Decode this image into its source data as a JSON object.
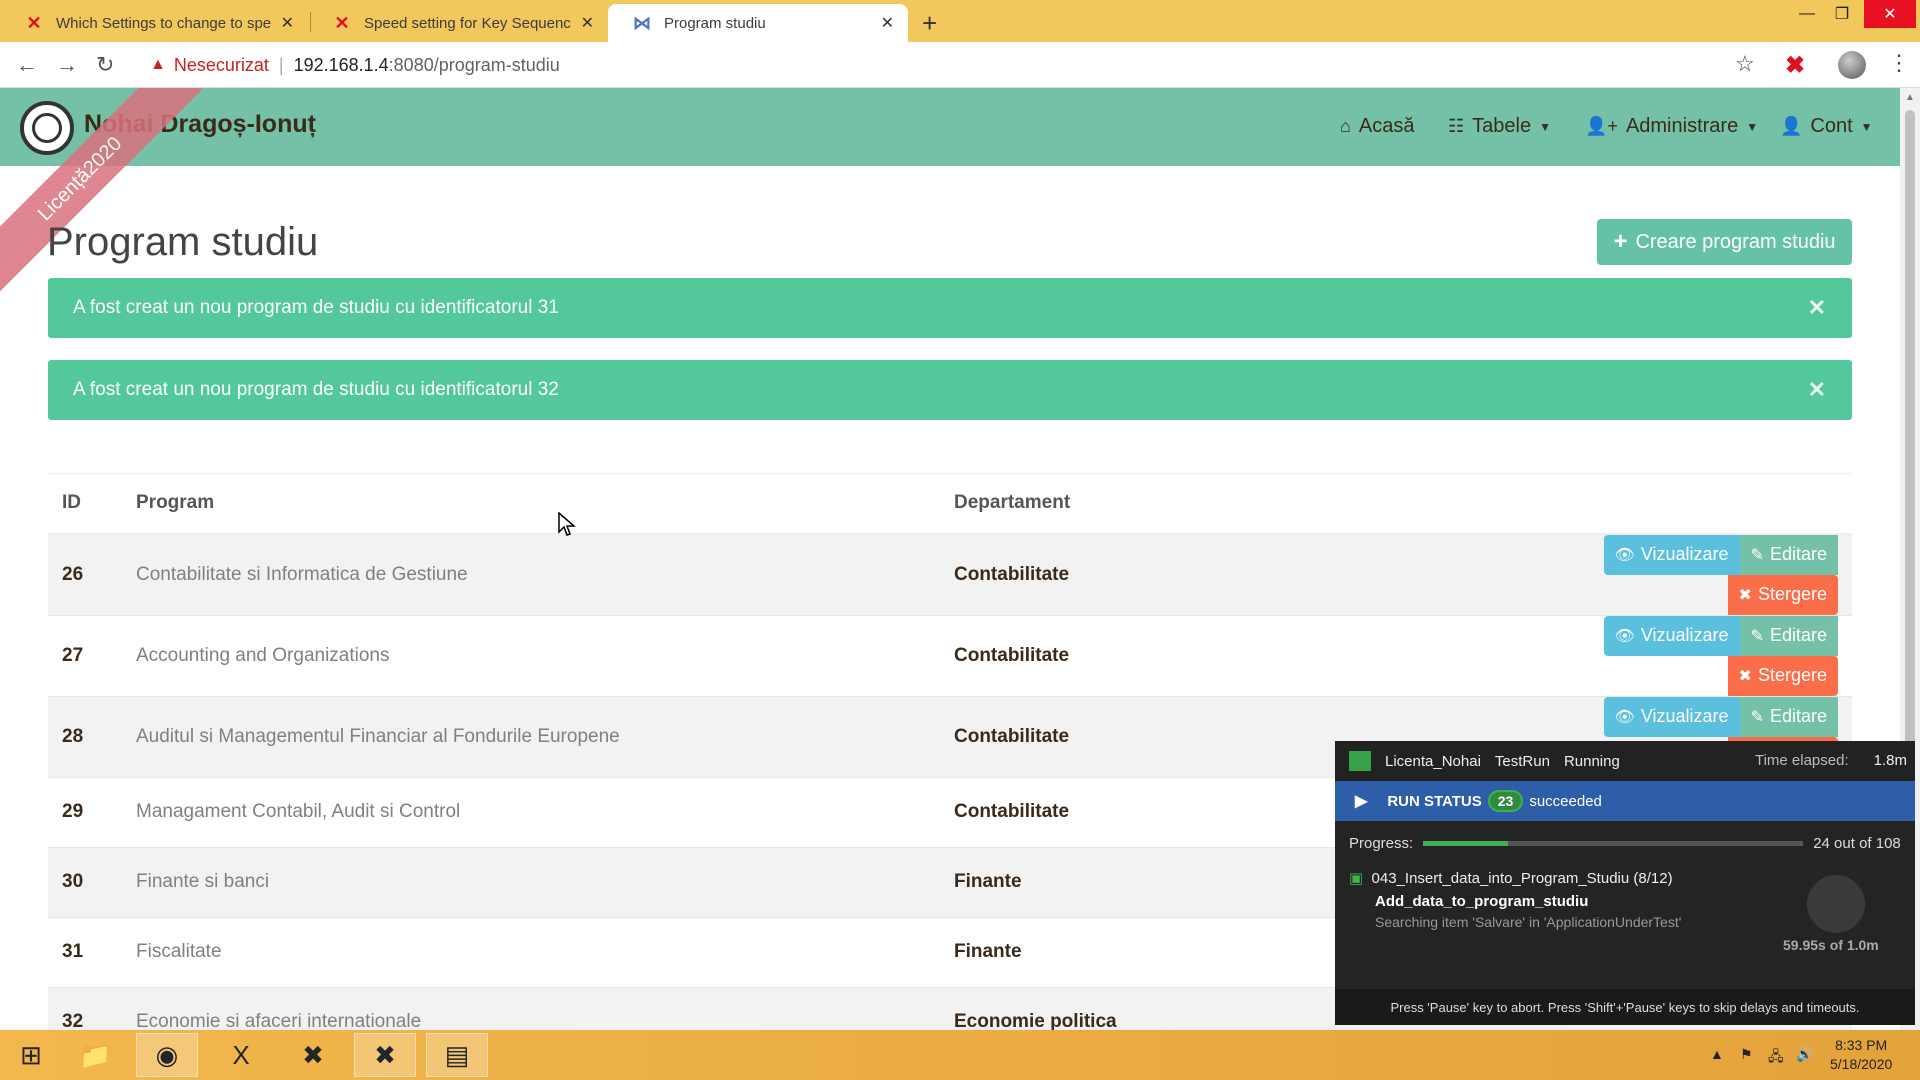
{
  "browser": {
    "tabs": [
      {
        "title": "Which Settings to change to spe"
      },
      {
        "title": "Speed setting for Key Sequence /"
      },
      {
        "title": "Program studiu"
      }
    ],
    "insecure_label": "Nesecurizat",
    "host": "192.168.1.4",
    "path": ":8080/program-studiu"
  },
  "navbar": {
    "brand": "Nohai Dragoș-Ionuț",
    "ribbon": "Licență2020",
    "items": [
      {
        "label": "Acasă",
        "icon": "home-icon"
      },
      {
        "label": "Tabele",
        "icon": "table-icon"
      },
      {
        "label": "Administrare",
        "icon": "user-plus-icon"
      },
      {
        "label": "Cont",
        "icon": "user-icon"
      }
    ]
  },
  "page": {
    "title": "Program studiu",
    "create_button": "Creare program studiu",
    "alerts": [
      "A fost creat un nou program de studiu cu identificatorul 31",
      "A fost creat un nou program de studiu cu identificatorul 32"
    ]
  },
  "table": {
    "headers": {
      "id": "ID",
      "program": "Program",
      "dept": "Departament"
    },
    "actions": {
      "view": "Vizualizare",
      "edit": "Editare",
      "delete": "Stergere"
    },
    "rows": [
      {
        "id": "26",
        "program": "Contabilitate si Informatica de Gestiune",
        "dept": "Contabilitate"
      },
      {
        "id": "27",
        "program": "Accounting and Organizations",
        "dept": "Contabilitate"
      },
      {
        "id": "28",
        "program": "Auditul si Managementul Financiar al Fondurile Europene",
        "dept": "Contabilitate"
      },
      {
        "id": "29",
        "program": "Managament Contabil, Audit si Control",
        "dept": "Contabilitate"
      },
      {
        "id": "30",
        "program": "Finante si banci",
        "dept": "Finante"
      },
      {
        "id": "31",
        "program": "Fiscalitate",
        "dept": "Finante"
      },
      {
        "id": "32",
        "program": "Economie si afaceri internationale",
        "dept": "Economie politica"
      }
    ]
  },
  "ranorex": {
    "solution": "Licenta_Nohai",
    "suite": "TestRun",
    "state": "Running",
    "elapsed_label": "Time elapsed:",
    "elapsed": "1.8m",
    "run_status": "RUN STATUS",
    "succeeded_count": "23",
    "succeeded_label": "succeeded",
    "progress_label": "Progress:",
    "progress_text": "24 out of 108",
    "progress_fraction": 0.222,
    "module": "043_Insert_data_into_Program_Studiu (8/12)",
    "action": "Add_data_to_program_studiu",
    "searching": "Searching item 'Salvare' in 'ApplicationUnderTest'",
    "timeout": "59.95s of 1.0m",
    "footer": "Press 'Pause' key to abort. Press 'Shift'+'Pause' keys to skip delays and timeouts."
  },
  "taskbar": {
    "time": "8:33 PM",
    "date": "5/18/2020"
  }
}
